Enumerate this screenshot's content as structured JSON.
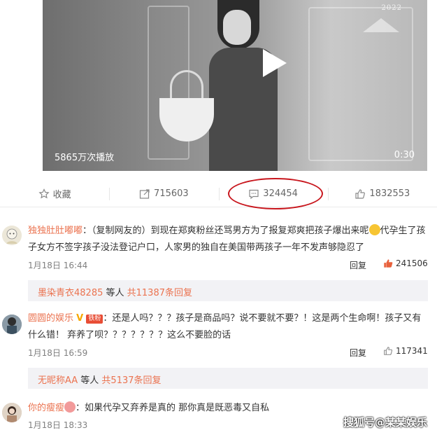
{
  "video": {
    "views_label": "5865万次播放",
    "duration": "0:30",
    "logo_text": "2022"
  },
  "actions": {
    "favorite": "收藏",
    "repost_count": "715603",
    "comment_count": "324454",
    "like_count": "1832553"
  },
  "comments": [
    {
      "username": "独独肚肚嘟嘟",
      "text_before": "：（复制网友的）到现在郑爽粉丝还骂男方为了报复郑爽把孩子爆出来呢",
      "text_after": "代孕生了孩子女方不签字孩子没法登记户口，人家男的独自在美国带两孩子一年不发声够隐忍了",
      "time": "1月18日 16:44",
      "reply": "回复",
      "likes": "241506",
      "sub_user": "墨染青衣48285",
      "sub_text": " 等人 ",
      "sub_count": "共11387条回复"
    },
    {
      "username": "圆圆的娱乐",
      "badge": "铁粉",
      "text": "：还是人吗？？？孩子是商品吗？说不要就不要？！这是两个生命啊！孩子又有什么错！ 弃养了呗？？？？？？？这么不要脸的话",
      "time": "1月18日 16:59",
      "reply": "回复",
      "likes": "117341",
      "sub_user": "无昵称AA",
      "sub_text": " 等人 ",
      "sub_count": "共5137条回复"
    },
    {
      "username": "你的瘦瘦",
      "text": "：如果代孕又弃养是真的 那你真是既恶毒又自私",
      "time": "1月18日 18:33"
    }
  ],
  "watermark": "搜狐号@某某娱乐",
  "colors": {
    "username": "#eb7350",
    "annotation": "#c8161d",
    "like_icon": "#e8613c"
  }
}
